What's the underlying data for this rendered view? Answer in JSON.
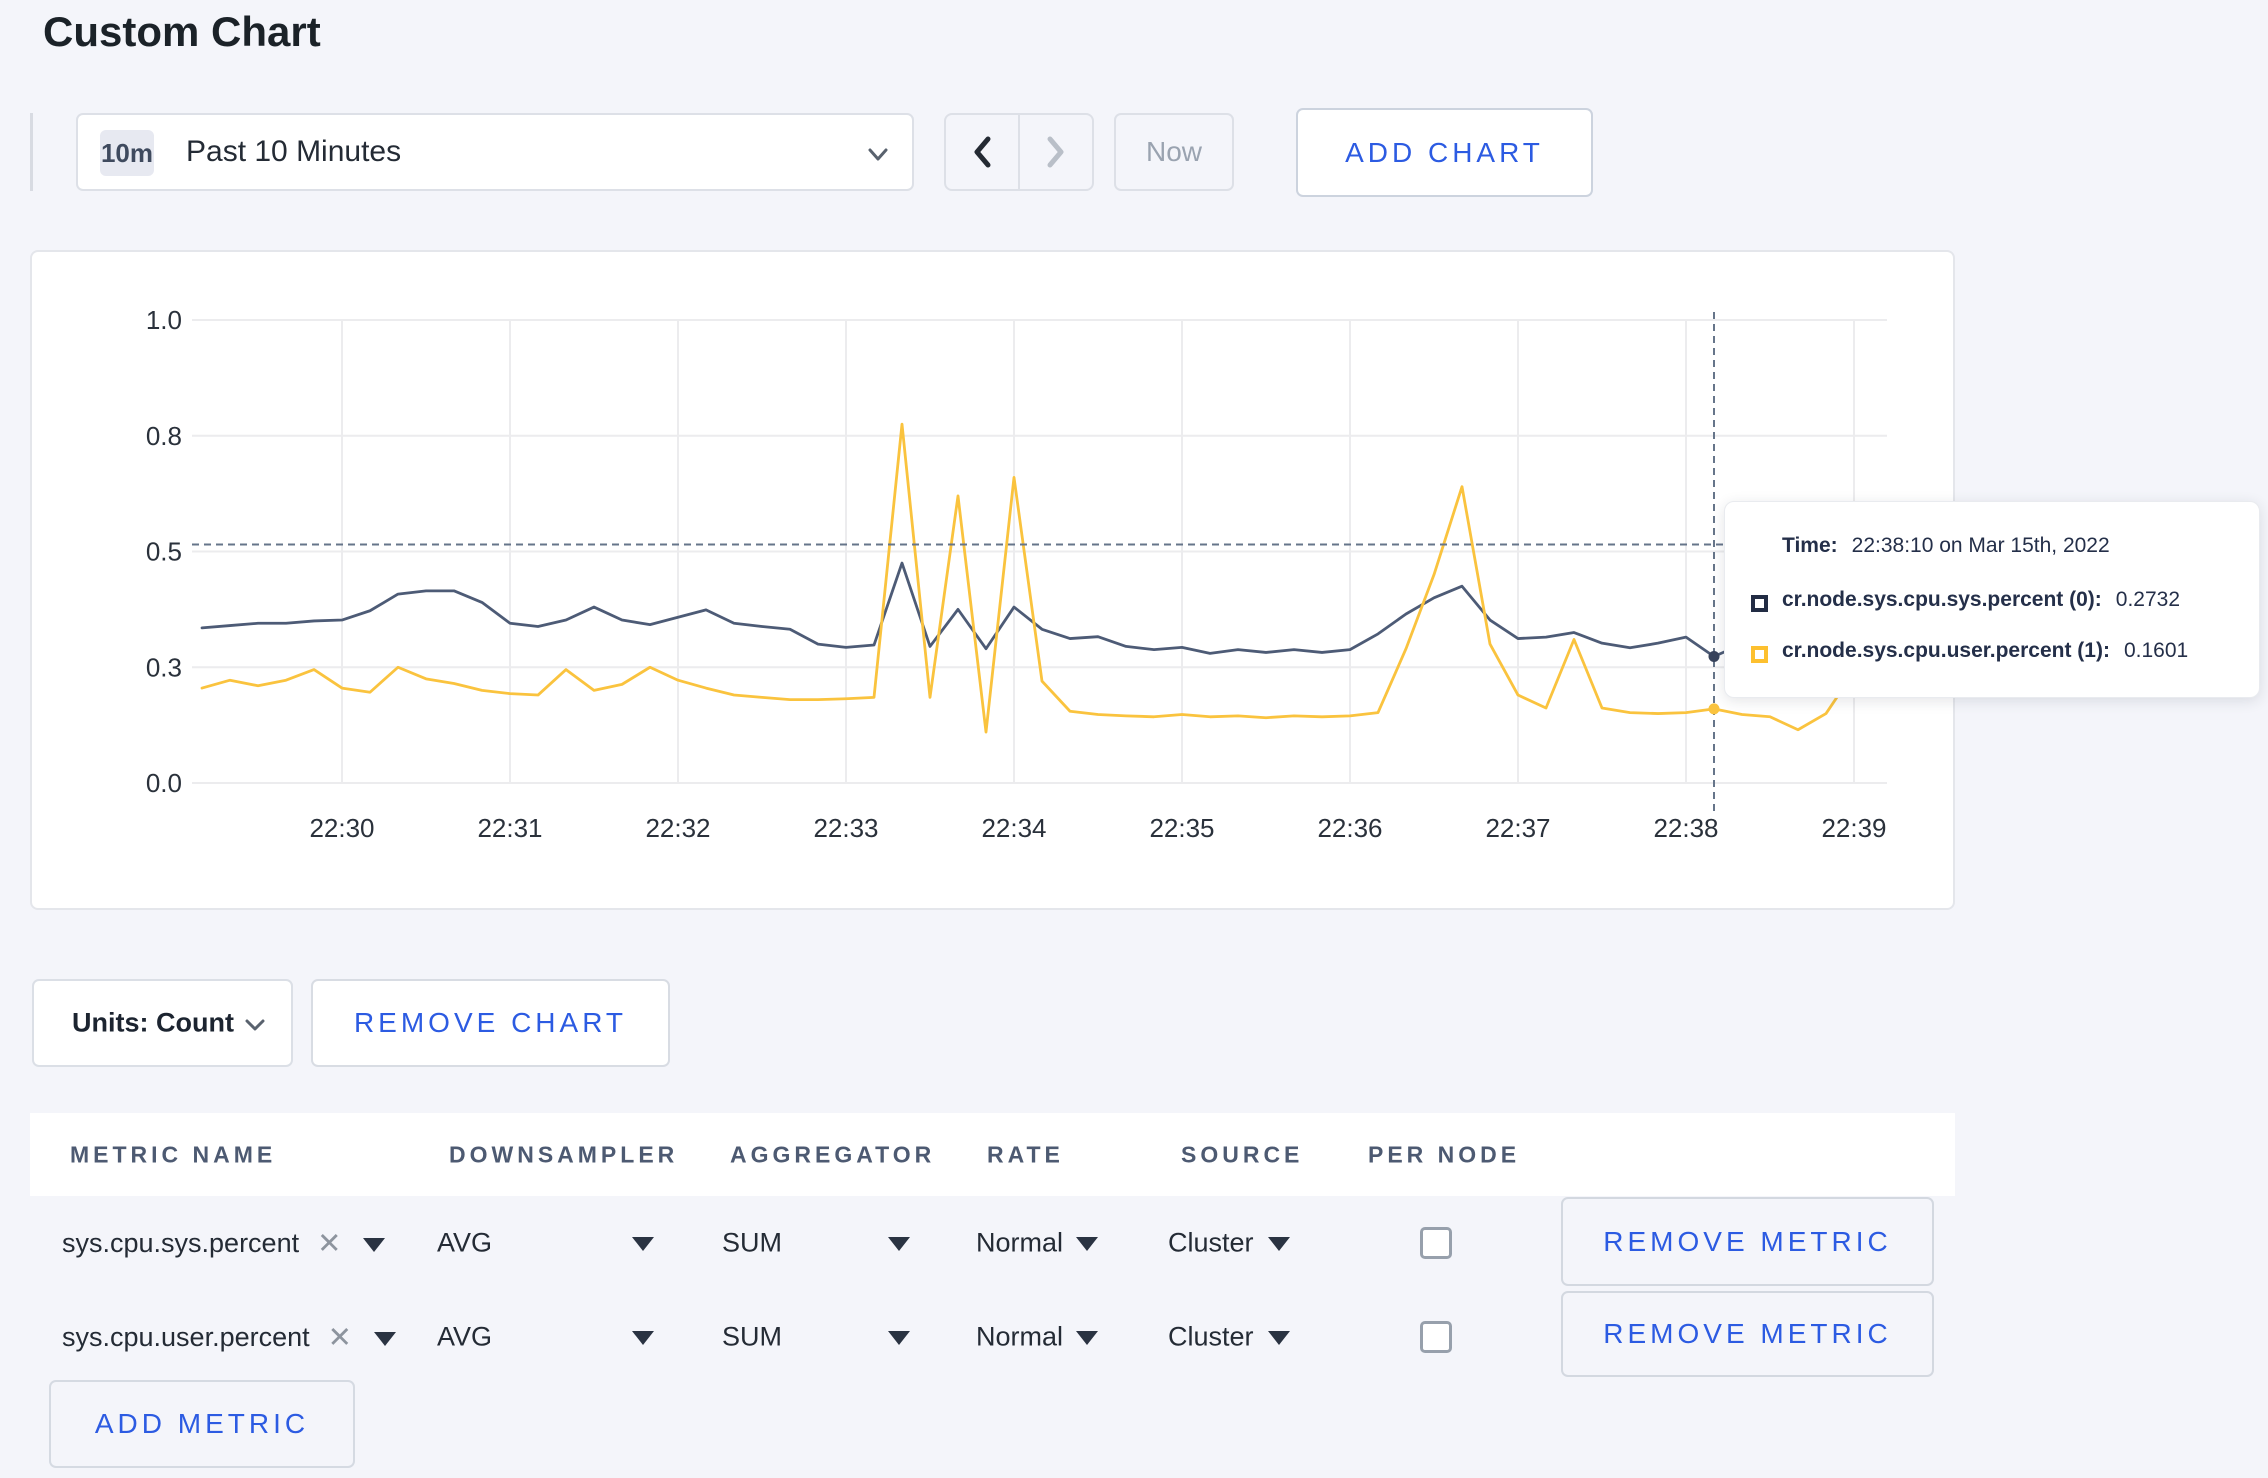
{
  "page": {
    "title": "Custom Chart"
  },
  "toolbar": {
    "time_badge": "10m",
    "time_range_label": "Past 10 Minutes",
    "now_label": "Now",
    "add_chart_label": "ADD CHART"
  },
  "icons": {
    "close": "✕"
  },
  "chart_data": {
    "type": "line",
    "title": "",
    "xlabel": "",
    "ylabel": "",
    "ylim": [
      0,
      1
    ],
    "grid": true,
    "x_start_time": "22:29:10",
    "x_step_seconds": 10,
    "x_tick_labels": [
      "22:30",
      "22:31",
      "22:32",
      "22:33",
      "22:34",
      "22:35",
      "22:36",
      "22:37",
      "22:38",
      "22:39"
    ],
    "y_tick_labels": [
      "1.0",
      "0.8",
      "0.5",
      "0.3",
      "0.0"
    ],
    "y_tick_values": [
      1.0,
      0.75,
      0.5,
      0.25,
      0.0
    ],
    "series": [
      {
        "name": "cr.node.sys.cpu.sys.percent (0)",
        "color": "#4d5b76",
        "values": [
          0.335,
          0.34,
          0.345,
          0.345,
          0.35,
          0.352,
          0.372,
          0.408,
          0.415,
          0.415,
          0.39,
          0.345,
          0.338,
          0.352,
          0.38,
          0.352,
          0.342,
          0.358,
          0.374,
          0.345,
          0.338,
          0.332,
          0.3,
          0.293,
          0.298,
          0.475,
          0.295,
          0.375,
          0.29,
          0.38,
          0.332,
          0.312,
          0.316,
          0.295,
          0.288,
          0.293,
          0.28,
          0.288,
          0.282,
          0.288,
          0.282,
          0.288,
          0.322,
          0.365,
          0.4,
          0.425,
          0.352,
          0.312,
          0.315,
          0.325,
          0.302,
          0.292,
          0.302,
          0.315,
          0.2732,
          0.3,
          0.292,
          0.31,
          0.302,
          0.31
        ]
      },
      {
        "name": "cr.node.sys.cpu.user.percent (1)",
        "color": "#fac33e",
        "values": [
          0.205,
          0.222,
          0.21,
          0.222,
          0.245,
          0.205,
          0.196,
          0.25,
          0.225,
          0.215,
          0.2,
          0.193,
          0.19,
          0.245,
          0.2,
          0.213,
          0.25,
          0.222,
          0.205,
          0.19,
          0.185,
          0.18,
          0.18,
          0.182,
          0.185,
          0.775,
          0.185,
          0.62,
          0.11,
          0.66,
          0.22,
          0.155,
          0.148,
          0.145,
          0.143,
          0.148,
          0.143,
          0.145,
          0.141,
          0.145,
          0.143,
          0.145,
          0.152,
          0.29,
          0.45,
          0.64,
          0.3,
          0.19,
          0.162,
          0.31,
          0.162,
          0.152,
          0.15,
          0.152,
          0.1601,
          0.148,
          0.143,
          0.115,
          0.15,
          0.24
        ]
      }
    ],
    "crosshair": {
      "point_index": 54,
      "hline_value": 0.515
    },
    "tooltip": {
      "time_label": "Time:",
      "time_value": "22:38:10 on Mar 15th, 2022",
      "entries": [
        {
          "label": "cr.node.sys.cpu.sys.percent (0):",
          "value": "0.2732",
          "color": "#222c44"
        },
        {
          "label": "cr.node.sys.cpu.user.percent (1):",
          "value": "0.1601",
          "color": "#fdc02f"
        }
      ]
    }
  },
  "chart_controls": {
    "units_label": "Units: Count",
    "remove_chart_label": "REMOVE CHART"
  },
  "metrics_table": {
    "headers": {
      "metric": "METRIC NAME",
      "downsampler": "DOWNSAMPLER",
      "aggregator": "AGGREGATOR",
      "rate": "RATE",
      "source": "SOURCE",
      "per_node": "PER NODE"
    },
    "rows": [
      {
        "metric": "sys.cpu.sys.percent",
        "downsampler": "AVG",
        "aggregator": "SUM",
        "rate": "Normal",
        "source": "Cluster",
        "per_node_checked": false,
        "remove_label": "REMOVE METRIC"
      },
      {
        "metric": "sys.cpu.user.percent",
        "downsampler": "AVG",
        "aggregator": "SUM",
        "rate": "Normal",
        "source": "Cluster",
        "per_node_checked": false,
        "remove_label": "REMOVE METRIC"
      }
    ],
    "add_metric_label": "ADD METRIC"
  }
}
